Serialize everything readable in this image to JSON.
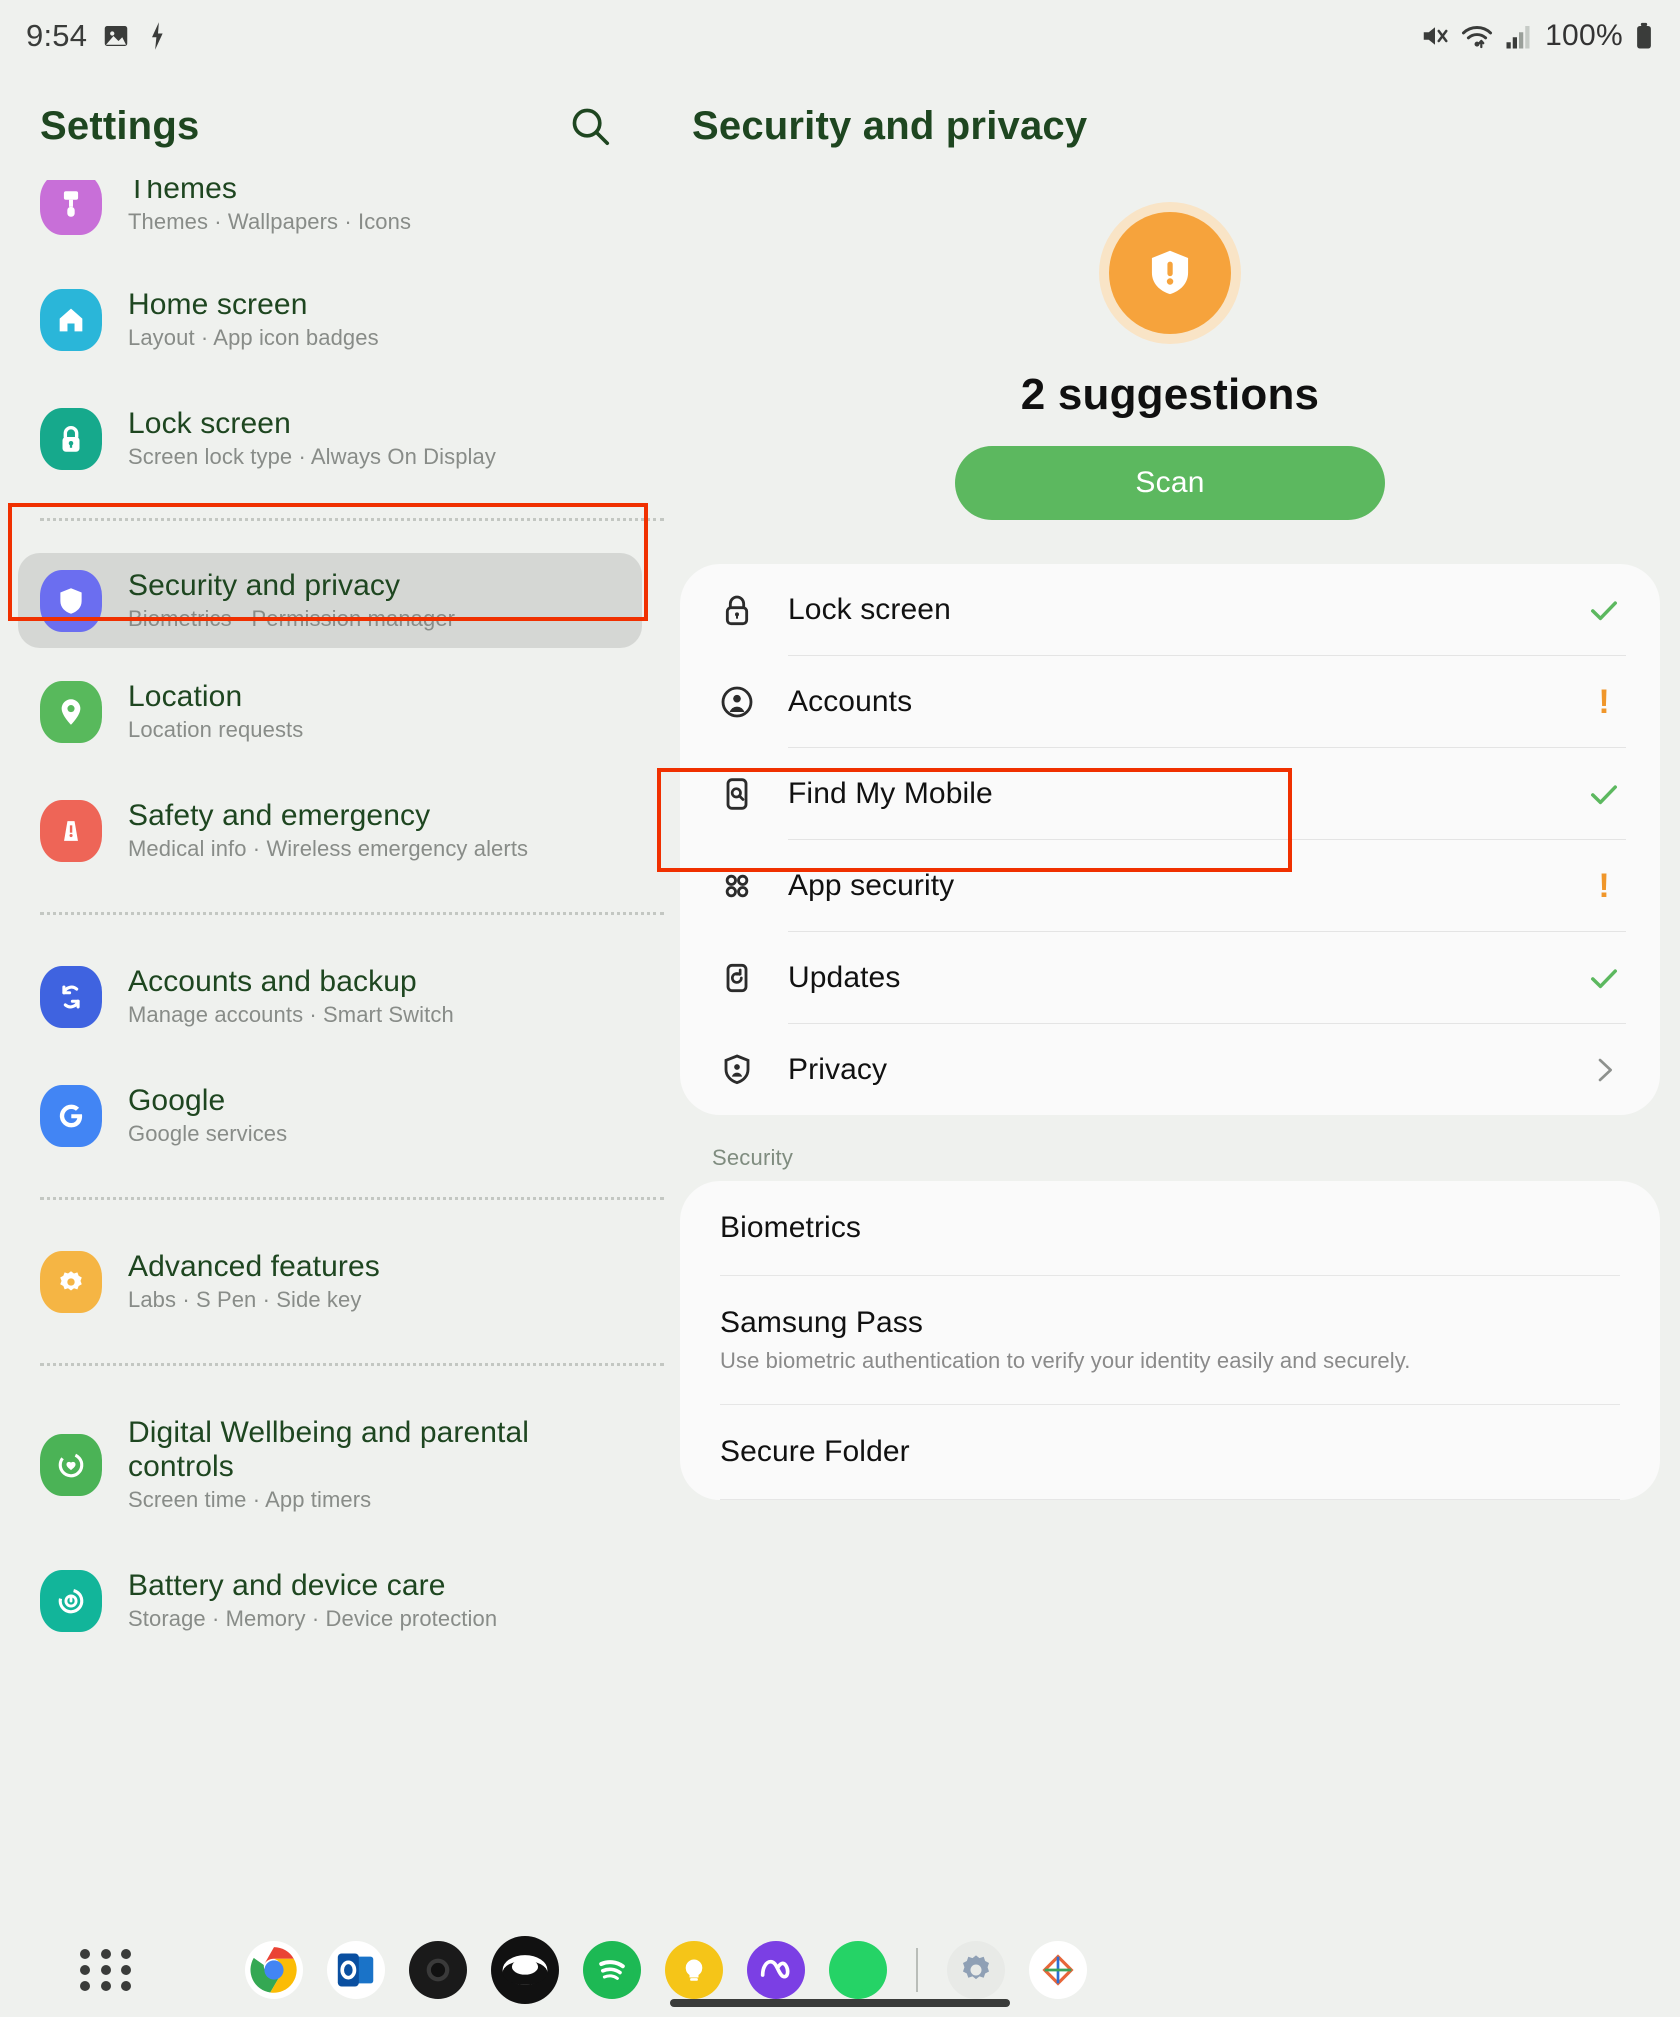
{
  "status_bar": {
    "time": "9:54",
    "icons_left": [
      "image-icon",
      "lightning-bolt-icon"
    ],
    "icons_right": [
      "mute-icon",
      "wifi-icon",
      "signal-icon"
    ],
    "battery_percent": "100%",
    "battery_icon": "battery-full-icon"
  },
  "left_pane": {
    "header": {
      "title": "Settings",
      "search_icon": "search-icon"
    },
    "items": [
      {
        "title": "Themes",
        "subtitle": "Themes  ·  Wallpapers  ·  Icons",
        "icon": "themes-icon",
        "icon_color": "#c86fd8",
        "selected": false,
        "partial": true
      },
      {
        "title": "Home screen",
        "subtitle": "Layout  ·  App icon badges",
        "icon": "home-icon",
        "icon_color": "#2ab6d9",
        "selected": false
      },
      {
        "title": "Lock screen",
        "subtitle": "Screen lock type  ·  Always On Display",
        "icon": "lock-icon",
        "icon_color": "#16a98c",
        "selected": false
      },
      {
        "title": "Security and privacy",
        "subtitle": "Biometrics  ·  Permission manager",
        "icon": "shield-icon",
        "icon_color": "#6b6ef0",
        "selected": true
      },
      {
        "title": "Location",
        "subtitle": "Location requests",
        "icon": "location-pin-icon",
        "icon_color": "#58b95c",
        "selected": false
      },
      {
        "title": "Safety and emergency",
        "subtitle": "Medical info  ·  Wireless emergency alerts",
        "icon": "emergency-icon",
        "icon_color": "#ee6557",
        "selected": false
      },
      {
        "title": "Accounts and backup",
        "subtitle": "Manage accounts  ·  Smart Switch",
        "icon": "sync-icon",
        "icon_color": "#3f63e0",
        "selected": false
      },
      {
        "title": "Google",
        "subtitle": "Google services",
        "icon": "google-icon",
        "icon_color": "#4285f4",
        "selected": false
      },
      {
        "title": "Advanced features",
        "subtitle": "Labs  ·  S Pen  ·  Side key",
        "icon": "gear-flower-icon",
        "icon_color": "#f5b544",
        "selected": false
      },
      {
        "title": "Digital Wellbeing and parental controls",
        "subtitle": "Screen time  ·  App timers",
        "icon": "wellbeing-icon",
        "icon_color": "#4bb356",
        "selected": false
      },
      {
        "title": "Battery and device care",
        "subtitle": "Storage  ·  Memory  ·  Device protection",
        "icon": "device-care-icon",
        "icon_color": "#12b59a",
        "selected": false
      }
    ]
  },
  "right_pane": {
    "header": {
      "title": "Security and privacy"
    },
    "suggestions": {
      "icon": "shield-alert-icon",
      "title": "2 suggestions",
      "scan_button": "Scan"
    },
    "status_card": [
      {
        "label": "Lock screen",
        "icon": "lock-icon",
        "status": "ok",
        "status_icon": "check-icon"
      },
      {
        "label": "Accounts",
        "icon": "account-icon",
        "status": "warn",
        "status_icon": "exclamation-icon"
      },
      {
        "label": "Find My Mobile",
        "icon": "find-my-mobile-icon",
        "status": "ok",
        "status_icon": "check-icon",
        "highlighted": true
      },
      {
        "label": "App security",
        "icon": "app-security-icon",
        "status": "warn",
        "status_icon": "exclamation-icon"
      },
      {
        "label": "Updates",
        "icon": "updates-icon",
        "status": "ok",
        "status_icon": "check-icon"
      },
      {
        "label": "Privacy",
        "icon": "privacy-icon",
        "status": "chevron",
        "status_icon": "chevron-right-icon"
      }
    ],
    "security_section": {
      "header": "Security",
      "items": [
        {
          "title": "Biometrics",
          "subtitle": ""
        },
        {
          "title": "Samsung Pass",
          "subtitle": "Use biometric authentication to verify your identity easily and securely."
        },
        {
          "title": "Secure Folder",
          "subtitle": ""
        }
      ]
    }
  },
  "dock": {
    "app_drawer_icon": "app-drawer-icon",
    "apps": [
      {
        "name": "chrome-icon",
        "color": "#ffffff"
      },
      {
        "name": "outlook-icon",
        "color": "#ffffff"
      },
      {
        "name": "camera-icon",
        "color": "#1a1a1a"
      },
      {
        "name": "samsung-internet-icon",
        "color": "#1a1a1a"
      },
      {
        "name": "spotify-icon",
        "color": "#1db954"
      },
      {
        "name": "bixby-icon",
        "color": "#f5c518"
      },
      {
        "name": "meta-ai-icon",
        "color": "#7b3fe4"
      },
      {
        "name": "whatsapp-icon",
        "color": "#25d366"
      },
      {
        "name": "settings-icon",
        "color": "#e8eae7"
      },
      {
        "name": "gallery-icon",
        "color": "#ffffff"
      }
    ]
  },
  "colors": {
    "background": "#eff1ee",
    "accent_green": "#5cb85f",
    "title_green": "#1e4620",
    "warn_orange": "#f0962a",
    "annotation_red": "#f03000",
    "card": "#fafafa"
  }
}
